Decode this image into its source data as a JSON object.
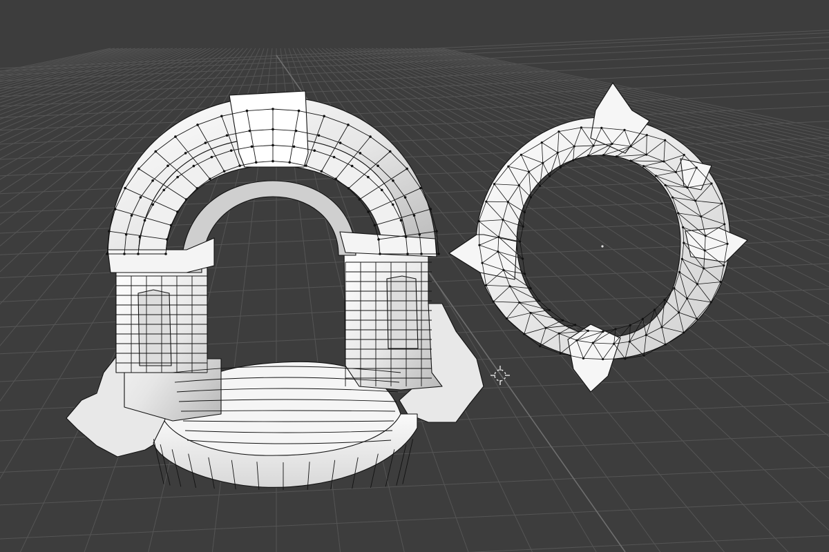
{
  "viewport": {
    "view": "perspective",
    "background_color": "#3d3d3d",
    "grid_color": "#555555",
    "shading": "solid",
    "wireframe_overlay": true
  },
  "objects": [
    {
      "name": "archway",
      "kind": "arch-mesh",
      "surface_color": "#f2f2f2",
      "wire_color": "#111111"
    },
    {
      "name": "spiked-ring",
      "kind": "ring-mesh",
      "surface_color": "#f0f0f0",
      "wire_color": "#111111"
    }
  ],
  "gizmos": {
    "cursor": {
      "icon": "3d-cursor-icon",
      "color": "#e8e8e8"
    }
  }
}
